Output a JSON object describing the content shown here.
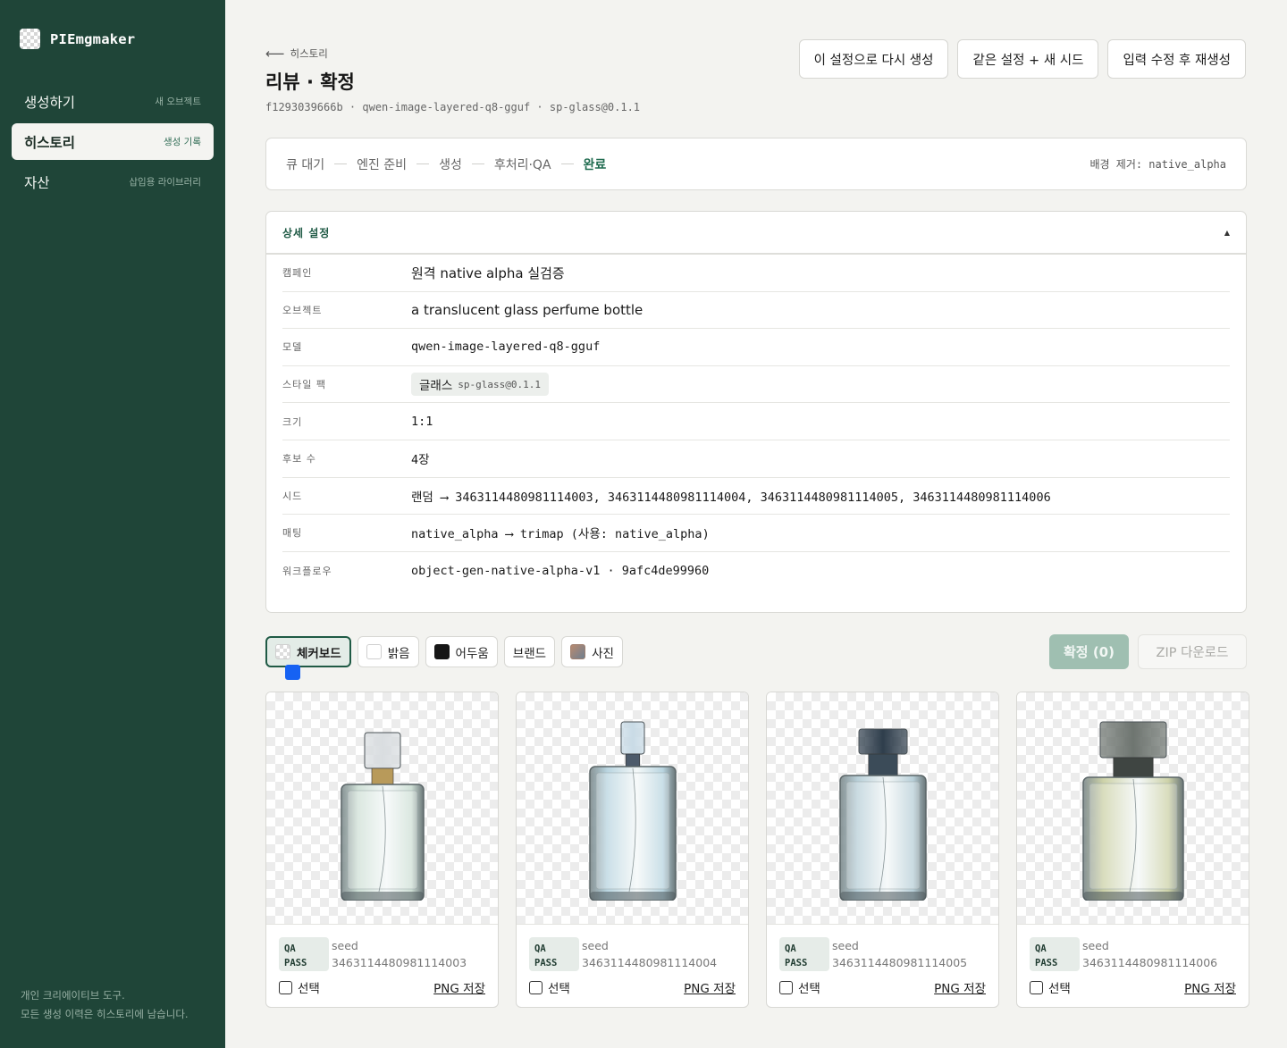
{
  "app": {
    "name": "PIEmgmaker"
  },
  "sidebar": {
    "items": [
      {
        "label": "생성하기",
        "hint": "새 오브젝트"
      },
      {
        "label": "히스토리",
        "hint": "생성 기록"
      },
      {
        "label": "자산",
        "hint": "삽입용 라이브러리"
      }
    ],
    "footer_line1": "개인 크리에이티브 도구.",
    "footer_line2": "모든 생성 이력은 히스토리에 남습니다."
  },
  "header": {
    "back_label": "히스토리",
    "title": "리뷰 · 확정",
    "meta": "f1293039666b · qwen-image-layered-q8-gguf · sp-glass@0.1.1",
    "actions": [
      "이 설정으로 다시 생성",
      "같은 설정 + 새 시드",
      "입력 수정 후 재생성"
    ]
  },
  "stepper": {
    "steps": [
      "큐 대기",
      "엔진 준비",
      "생성",
      "후처리·QA",
      "완료"
    ],
    "bg_removal": "배경 제거: native_alpha"
  },
  "details": {
    "title": "상세 설정",
    "caret": "▲",
    "rows": [
      {
        "key": "캠페인",
        "value": "원격 native alpha 실검증"
      },
      {
        "key": "오브젝트",
        "value": "a translucent glass perfume bottle"
      },
      {
        "key": "모델",
        "value": "qwen-image-layered-q8-gguf"
      },
      {
        "key": "스타일 팩",
        "value": "글래스",
        "sub": "sp-glass@0.1.1"
      },
      {
        "key": "크기",
        "value": "1:1"
      },
      {
        "key": "후보 수",
        "value": "4장"
      },
      {
        "key": "시드",
        "value": "랜덤 ⟶ 3463114480981114003, 3463114480981114004, 3463114480981114005, 3463114480981114006"
      },
      {
        "key": "매팅",
        "value": "native_alpha ⟶ trimap (사용: native_alpha)"
      },
      {
        "key": "워크플로우",
        "value": "object-gen-native-alpha-v1 · 9afc4de99960"
      }
    ]
  },
  "backgrounds": [
    "체커보드",
    "밝음",
    "어두움",
    "브랜드",
    "사진"
  ],
  "confirm_label": "확정 (0)",
  "zip_label": "ZIP 다운로드",
  "results": [
    {
      "qa1": "QA",
      "qa2": "PASS",
      "seed_label": "seed",
      "seed": "3463114480981114003",
      "select": "선택",
      "save": "PNG 저장",
      "tint": "#cfe0d6",
      "cap": "#d9dde0",
      "collar": "#b89a5a"
    },
    {
      "qa1": "QA",
      "qa2": "PASS",
      "seed_label": "seed",
      "seed": "3463114480981114004",
      "select": "선택",
      "save": "PNG 저장",
      "tint": "#b9d5e0",
      "cap": "#c9dbe6",
      "collar": "#4d5b6b"
    },
    {
      "qa1": "QA",
      "qa2": "PASS",
      "seed_label": "seed",
      "seed": "3463114480981114005",
      "select": "선택",
      "save": "PNG 저장",
      "tint": "#b8cfd8",
      "cap": "#2f3e4c",
      "collar": "#3b4b58"
    },
    {
      "qa1": "QA",
      "qa2": "PASS",
      "seed_label": "seed",
      "seed": "3463114480981114006",
      "select": "선택",
      "save": "PNG 저장",
      "tint": "#cdd2a8",
      "cap": "#6e7570",
      "collar": "#3f4542"
    }
  ]
}
